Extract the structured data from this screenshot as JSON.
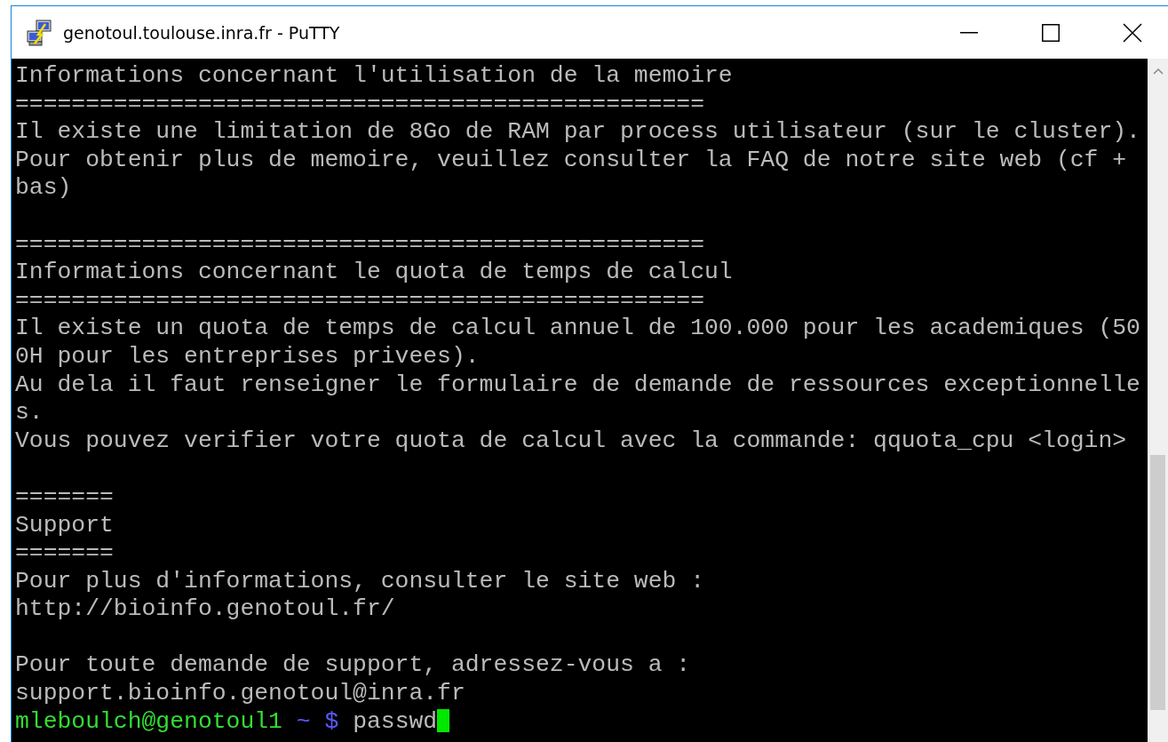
{
  "window": {
    "title": "genotoul.toulouse.inra.fr - PuTTY"
  },
  "terminal": {
    "lines": [
      {
        "kind": "text",
        "text": "Informations concernant l'utilisation de la memoire"
      },
      {
        "kind": "text",
        "text": "================================================="
      },
      {
        "kind": "text",
        "text": "Il existe une limitation de 8Go de RAM par process utilisateur (sur le cluster)."
      },
      {
        "kind": "text",
        "text": "Pour obtenir plus de memoire, veuillez consulter la FAQ de notre site web (cf +"
      },
      {
        "kind": "text",
        "text": "bas)"
      },
      {
        "kind": "blank"
      },
      {
        "kind": "text",
        "text": "================================================="
      },
      {
        "kind": "text",
        "text": "Informations concernant le quota de temps de calcul"
      },
      {
        "kind": "text",
        "text": "================================================="
      },
      {
        "kind": "text",
        "text": "Il existe un quota de temps de calcul annuel de 100.000 pour les academiques (50"
      },
      {
        "kind": "text",
        "text": "0H pour les entreprises privees)."
      },
      {
        "kind": "text",
        "text": "Au dela il faut renseigner le formulaire de demande de ressources exceptionnelle"
      },
      {
        "kind": "text",
        "text": "s."
      },
      {
        "kind": "text",
        "text": "Vous pouvez verifier votre quota de calcul avec la commande: qquota_cpu <login>"
      },
      {
        "kind": "blank"
      },
      {
        "kind": "text",
        "text": "======="
      },
      {
        "kind": "text",
        "text": "Support"
      },
      {
        "kind": "text",
        "text": "======="
      },
      {
        "kind": "text",
        "text": "Pour plus d'informations, consulter le site web :"
      },
      {
        "kind": "text",
        "text": "http://bioinfo.genotoul.fr/"
      },
      {
        "kind": "blank"
      },
      {
        "kind": "text",
        "text": "Pour toute demande de support, adressez-vous a :"
      },
      {
        "kind": "text",
        "text": "support.bioinfo.genotoul@inra.fr"
      },
      {
        "kind": "prompt",
        "user_host": "mleboulch@genotoul1",
        "path": "~",
        "symbol": "$",
        "command": "passwd",
        "cursor": true
      }
    ]
  }
}
